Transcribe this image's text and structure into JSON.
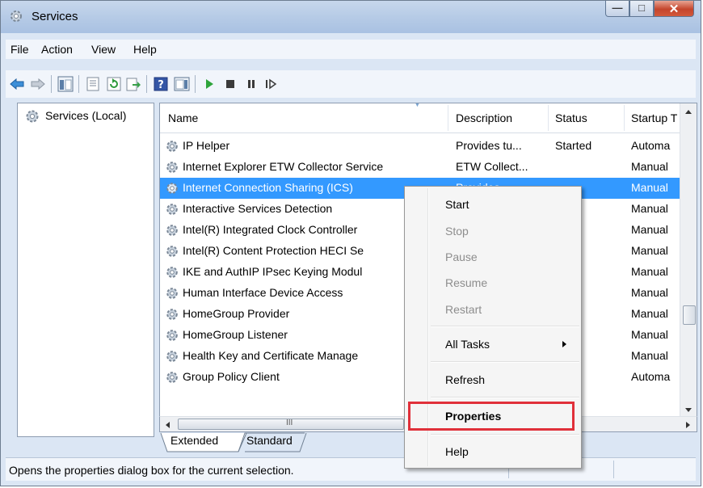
{
  "window": {
    "title": "Services"
  },
  "caption_buttons": {
    "minimize": "—",
    "maximize": "□",
    "close": "✕"
  },
  "menu": [
    "File",
    "Action",
    "View",
    "Help"
  ],
  "toolbar_icons": [
    "back-icon",
    "forward-icon",
    "show-hide-console-tree-icon",
    "properties-icon",
    "refresh-icon",
    "export-list-icon",
    "help-icon",
    "show-action-pane-icon",
    "start-service-icon",
    "stop-service-icon",
    "pause-service-icon",
    "resume-service-icon"
  ],
  "tree": {
    "root": "Services (Local)"
  },
  "columns": {
    "name": "Name",
    "description": "Description",
    "status": "Status",
    "startup": "Startup T"
  },
  "rows": [
    {
      "name": "IP Helper",
      "description": "Provides tu...",
      "status": "Started",
      "startup": "Automa"
    },
    {
      "name": "Internet Explorer ETW Collector Service",
      "description": "ETW Collect...",
      "status": "",
      "startup": "Manual"
    },
    {
      "name": "Internet Connection Sharing (ICS)",
      "description": "Provides...",
      "status": "",
      "startup": "Manual",
      "selected": true
    },
    {
      "name": "Interactive Services Detection",
      "description": "",
      "status": "",
      "startup": "Manual"
    },
    {
      "name": "Intel(R) Integrated Clock Controller",
      "description": "",
      "status": "ted",
      "startup": "Manual"
    },
    {
      "name": "Intel(R) Content Protection HECI Se",
      "description": "",
      "status": "",
      "startup": "Manual"
    },
    {
      "name": "IKE and AuthIP IPsec Keying Modul",
      "description": "",
      "status": "",
      "startup": "Manual"
    },
    {
      "name": "Human Interface Device Access",
      "description": "",
      "status": "ted",
      "startup": "Manual"
    },
    {
      "name": "HomeGroup Provider",
      "description": "",
      "status": "ted",
      "startup": "Manual"
    },
    {
      "name": "HomeGroup Listener",
      "description": "",
      "status": "",
      "startup": "Manual"
    },
    {
      "name": "Health Key and Certificate Manage",
      "description": "",
      "status": "",
      "startup": "Manual"
    },
    {
      "name": "Group Policy Client",
      "description": "",
      "status": "ted",
      "startup": "Automa"
    }
  ],
  "hscroll": {
    "thumb_grip": "III"
  },
  "tabs": {
    "extended": "Extended",
    "standard": "Standard"
  },
  "status": {
    "text": "Opens the properties dialog box for the current selection."
  },
  "context_menu": {
    "start": "Start",
    "stop": "Stop",
    "pause": "Pause",
    "resume": "Resume",
    "restart": "Restart",
    "all_tasks": "All Tasks",
    "refresh": "Refresh",
    "properties": "Properties",
    "help": "Help"
  },
  "colors": {
    "selection": "#3399ff",
    "highlight_box": "#e0303a",
    "chrome": "#dbe6f4"
  }
}
